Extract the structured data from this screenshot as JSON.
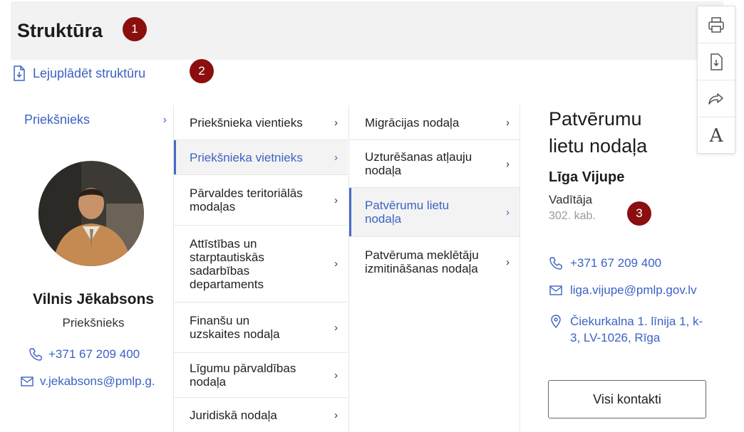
{
  "header": {
    "title": "Struktūra"
  },
  "badges": [
    "1",
    "2",
    "3"
  ],
  "download": {
    "label": "Lejuplādēt struktūru"
  },
  "toolbar": {
    "items": [
      "printer-icon",
      "file-download-icon",
      "share-icon",
      "font-size-icon"
    ],
    "font_letter": "A"
  },
  "column1": {
    "heading": "Priekšnieks",
    "person": {
      "name": "Vilnis Jēkabsons",
      "role": "Priekšnieks",
      "phone": "+371 67 209 400",
      "email": "v.jekabsons@pmlp.g."
    }
  },
  "column2": {
    "items": [
      {
        "label": "Priekšnieka vientieks",
        "active": false
      },
      {
        "label": "Priekšnieka vietnieks",
        "active": true
      },
      {
        "label": "Pārvaldes teritoriālās modaļas",
        "active": false
      },
      {
        "label": "Attīstības un starptautiskās sadarbības departaments",
        "active": false
      },
      {
        "label": "Finanšu un uzskaites nodaļa",
        "active": false
      },
      {
        "label": "Līgumu pārvaldības nodaļa",
        "active": false
      },
      {
        "label": "Juridiskā nodaļa",
        "active": false
      }
    ]
  },
  "column3": {
    "items": [
      {
        "label": "Migrācijas nodaļa",
        "active": false
      },
      {
        "label": "Uzturēšanas atļauju nodaļa",
        "active": false
      },
      {
        "label": "Patvērumu lietu nodaļa",
        "active": true
      },
      {
        "label": "Patvēruma meklētāju izmitināšanas nodaļa",
        "active": false
      }
    ]
  },
  "detail": {
    "title": "Patvērumu lietu nodaļa",
    "name": "Līga Vijupe",
    "role": "Vadītāja",
    "room": "302. kab.",
    "phone": "+371 67 209 400",
    "email": "liga.vijupe@pmlp.gov.lv",
    "address": "Čiekurkalna 1. līnija 1, k-3, LV-1026, Rīga",
    "button": "Visi kontakti"
  },
  "colors": {
    "accent": "#3d62c4",
    "badge": "#8b0f0f",
    "active_bar": "#4a69c6"
  }
}
